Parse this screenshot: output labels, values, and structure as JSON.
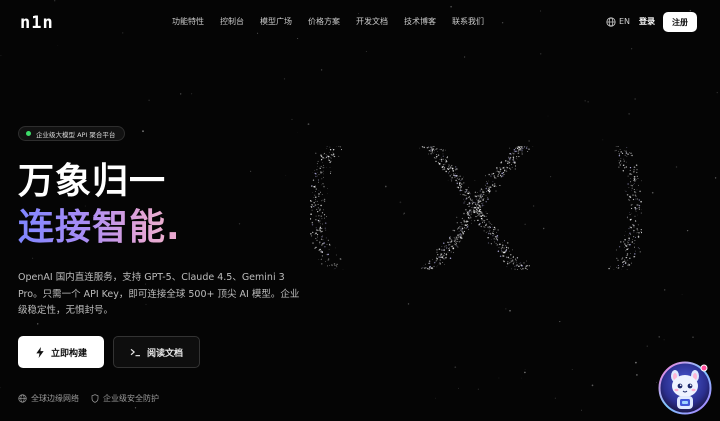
{
  "header": {
    "logo": "n1n",
    "nav": [
      "功能特性",
      "控制台",
      "模型广场",
      "价格方案",
      "开发文档",
      "技术博客",
      "联系我们"
    ],
    "lang": "EN",
    "login": "登录",
    "signup": "注册"
  },
  "hero": {
    "badge": "企业级大模型 API 聚合平台",
    "title_line1": "万象归一",
    "title_line2": "连接智能",
    "title_period": ".",
    "description": "OpenAI 国内直连服务，支持 GPT-5、Claude 4.5、Gemini 3 Pro。只需一个 API Key，即可连接全球 500+ 顶尖 AI 模型。企业级稳定性，无惧封号。",
    "primary_button": "立即构建",
    "secondary_button": "阅读文档",
    "features": [
      "全球边缘网络",
      "企业级安全防护"
    ]
  },
  "colors": {
    "background": "#050505",
    "badge_dot": "#3ddc6a",
    "gradient_start": "#7f86ff",
    "gradient_end": "#f0b6c9"
  },
  "icons": {
    "globe": "globe-icon",
    "bolt": "bolt-icon",
    "terminal": "terminal-icon",
    "shield": "shield-icon",
    "mascot": "mascot-avatar"
  }
}
